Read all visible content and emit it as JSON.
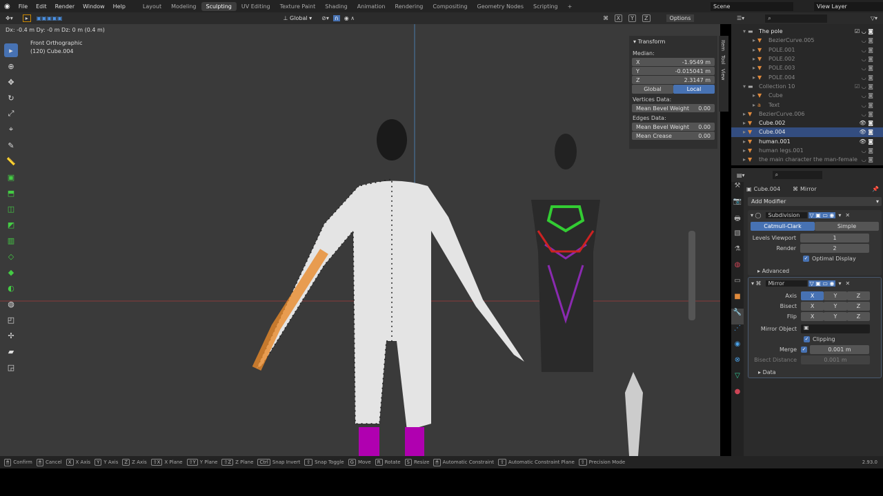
{
  "menu": [
    "File",
    "Edit",
    "Render",
    "Window",
    "Help"
  ],
  "workspaces": [
    "Layout",
    "Modeling",
    "Sculpting",
    "UV Editing",
    "Texture Paint",
    "Shading",
    "Animation",
    "Rendering",
    "Compositing",
    "Geometry Nodes",
    "Scripting",
    "+"
  ],
  "active_workspace": "Sculpting",
  "scene": "Scene",
  "view_layer": "View Layer",
  "header": {
    "orientation": "Global",
    "options": "Options",
    "axes": [
      "X",
      "Y",
      "Z"
    ]
  },
  "viewport": {
    "delta": "Dx: -0.4 m  Dy: -0 m  Dz: 0 m (0.4 m)",
    "view_name": "Front Orthographic",
    "object": "(120) Cube.004"
  },
  "npanel": {
    "title": "Transform",
    "median": "Median:",
    "x_label": "X",
    "x": "-1.9549 m",
    "y_label": "Y",
    "y": "-0.015041 m",
    "z_label": "Z",
    "z": "2.3147 m",
    "global": "Global",
    "local": "Local",
    "vertices_data": "Vertices Data:",
    "edges_data": "Edges Data:",
    "mean_bevel_weight": "Mean Bevel Weight",
    "vbw": "0.00",
    "ebw": "0.00",
    "mean_crease": "Mean Crease",
    "crease": "0.00",
    "tabs": [
      "Item",
      "Tool",
      "View"
    ]
  },
  "outliner": [
    {
      "name": "The pole",
      "level": 1,
      "type": "collection"
    },
    {
      "name": "BezierCurve.005",
      "level": 2,
      "type": "mesh",
      "dim": true
    },
    {
      "name": "POLE.001",
      "level": 2,
      "type": "mesh",
      "dim": true
    },
    {
      "name": "POLE.002",
      "level": 2,
      "type": "mesh",
      "dim": true
    },
    {
      "name": "POLE.003",
      "level": 2,
      "type": "mesh",
      "dim": true
    },
    {
      "name": "POLE.004",
      "level": 2,
      "type": "mesh",
      "dim": true
    },
    {
      "name": "Collection 10",
      "level": 1,
      "type": "collection",
      "dim": true
    },
    {
      "name": "Cube",
      "level": 2,
      "type": "mesh",
      "dim": true
    },
    {
      "name": "Text",
      "level": 2,
      "type": "text",
      "dim": true
    },
    {
      "name": "BezierCurve.006",
      "level": 1,
      "type": "mesh",
      "dim": true
    },
    {
      "name": "Cube.002",
      "level": 1,
      "type": "mesh"
    },
    {
      "name": "Cube.004",
      "level": 1,
      "type": "mesh",
      "selected": true
    },
    {
      "name": "human.001",
      "level": 1,
      "type": "mesh"
    },
    {
      "name": "human legs.001",
      "level": 1,
      "type": "mesh",
      "dim": true
    },
    {
      "name": "the main character the  man-female",
      "level": 1,
      "type": "mesh",
      "dim": true
    }
  ],
  "properties": {
    "object": "Cube.004",
    "modifier": "Mirror",
    "add_modifier": "Add Modifier",
    "subdivision": {
      "name": "Subdivision",
      "catmull": "Catmull-Clark",
      "simple": "Simple",
      "levels_label": "Levels Viewport",
      "levels": "1",
      "render_label": "Render",
      "render": "2",
      "optimal": "Optimal Display",
      "advanced": "Advanced"
    },
    "mirror": {
      "name": "Mirror",
      "axis": "Axis",
      "bisect": "Bisect",
      "flip": "Flip",
      "x": "X",
      "y": "Y",
      "z": "Z",
      "mirror_object": "Mirror Object",
      "clipping": "Clipping",
      "merge": "Merge",
      "merge_value": "0.001 m",
      "bisect_distance": "Bisect Distance",
      "bisect_value": "0.001 m",
      "data": "Data"
    }
  },
  "status": [
    [
      "Confirm",
      ""
    ],
    [
      "Cancel",
      ""
    ],
    [
      "X Axis",
      "X"
    ],
    [
      "Y Axis",
      "Y"
    ],
    [
      "Z Axis",
      "Z"
    ],
    [
      "X Plane",
      "⇧X"
    ],
    [
      "Y Plane",
      "⇧Y"
    ],
    [
      "Z Plane",
      "⇧Z"
    ],
    [
      "Snap Invert",
      "Ctrl"
    ],
    [
      "Snap Toggle",
      "⇧"
    ],
    [
      "Move",
      "G"
    ],
    [
      "Rotate",
      "R"
    ],
    [
      "Resize",
      "S"
    ],
    [
      "Automatic Constraint",
      ""
    ],
    [
      "Automatic Constraint Plane",
      "⇧"
    ],
    [
      "Precision Mode",
      "⇧"
    ]
  ],
  "version": "2.93.0"
}
